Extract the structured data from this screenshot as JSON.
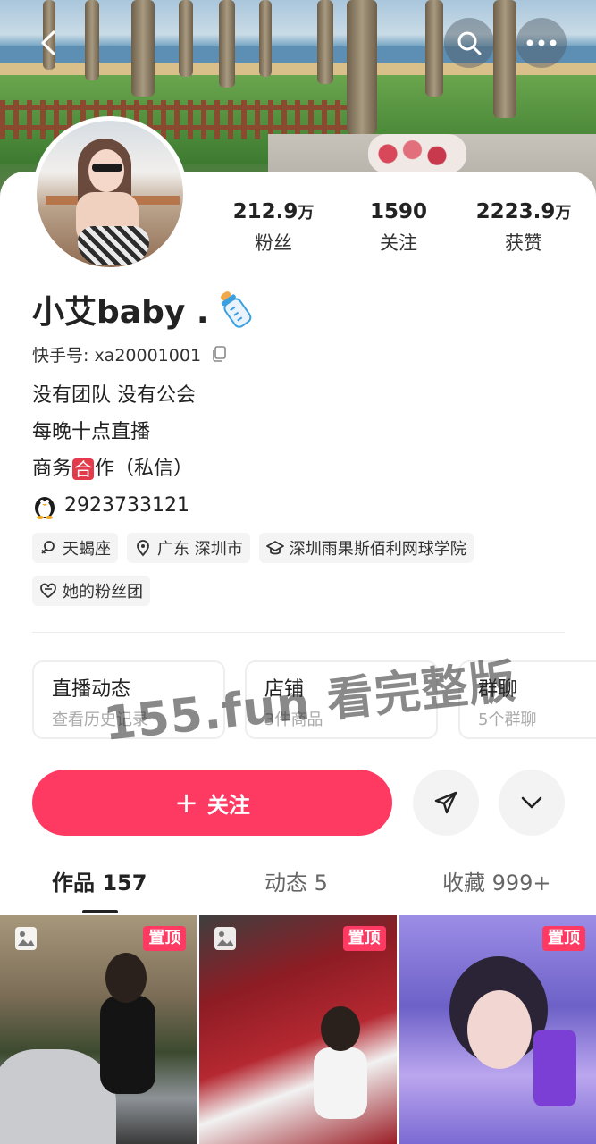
{
  "profile": {
    "name": "小艾baby .",
    "uid_text": "快手号: xa20001001",
    "bio": [
      "没有团队 没有公会",
      "每晚十点直播",
      "商务",
      "合",
      "作（私信）",
      "2923733121"
    ]
  },
  "stats": [
    {
      "value": "212.9",
      "unit": "万",
      "label": "粉丝"
    },
    {
      "value": "1590",
      "unit": "",
      "label": "关注"
    },
    {
      "value": "2223.9",
      "unit": "万",
      "label": "获赞"
    }
  ],
  "tags": [
    "天蝎座",
    "广东 深圳市",
    "深圳雨果斯佰利网球学院",
    "她的粉丝团"
  ],
  "features": [
    {
      "title": "直播动态",
      "subtitle": "查看历史记录"
    },
    {
      "title": "店铺",
      "subtitle": "3件商品"
    },
    {
      "title": "群聊",
      "subtitle": "5个群聊"
    }
  ],
  "watermark": {
    "url": "155.fun",
    "text": "看完整版"
  },
  "actions": {
    "follow_plus": "+",
    "follow_label": "关注"
  },
  "tabs": [
    {
      "label": "作品 157"
    },
    {
      "label": "动态 5"
    },
    {
      "label": "收藏 999+"
    }
  ],
  "grid": [
    {
      "badge": "置顶",
      "icon": "image-icon"
    },
    {
      "badge": "置顶",
      "icon": "image-icon"
    },
    {
      "badge": "置顶",
      "icon": ""
    }
  ],
  "icons": {
    "back": "back-arrow-icon",
    "search": "search-icon",
    "more": "more-dots-icon",
    "copy": "copy-icon",
    "penguin": "penguin-icon",
    "bottle": "baby-bottle-icon",
    "share": "send-icon",
    "expand": "chevron-down-icon"
  },
  "colors": {
    "accent": "#fe3a63",
    "badge": "#fe3a63",
    "he_badge": "#e33b4a"
  }
}
